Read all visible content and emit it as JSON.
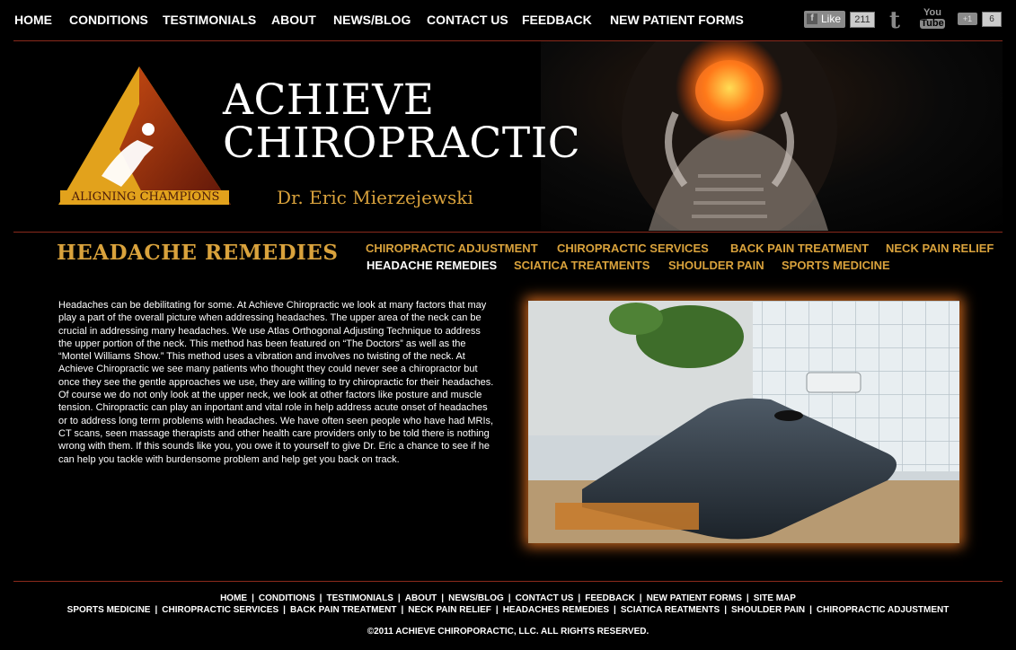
{
  "top_nav": {
    "items": [
      "HOME",
      "CONDITIONS",
      "TESTIMONIALS",
      "ABOUT",
      "NEWS/BLOG",
      "CONTACT US",
      "FEEDBACK",
      "NEW PATIENT FORMS"
    ]
  },
  "social": {
    "facebook_label": "Like",
    "facebook_count": "211",
    "twitter_glyph": "t",
    "youtube_top": "You",
    "youtube_bottom": "Tube",
    "gplus_label": "+1",
    "gplus_count": "6"
  },
  "banner": {
    "title_line1": "ACHIEVE",
    "title_line2": "CHIROPRACTIC",
    "doctor": "Dr. Eric Mierzejewski",
    "triangle_label": "ALIGNING CHAMPIONS"
  },
  "page": {
    "title": "HEADACHE REMEDIES"
  },
  "sub_nav": {
    "row1": [
      "CHIROPRACTIC ADJUSTMENT",
      "CHIROPRACTIC SERVICES",
      "BACK PAIN TREATMENT",
      "NECK PAIN RELIEF"
    ],
    "row2": [
      "HEADACHE REMEDIES",
      "SCIATICA TREATMENTS",
      "SHOULDER PAIN",
      "SPORTS MEDICINE"
    ],
    "active": "HEADACHE REMEDIES"
  },
  "body": {
    "text": "Headaches can be debilitating for some. At Achieve Chiropractic we look at many factors that may play a part of the overall picture when addressing headaches. The upper area of the neck can be crucial in addressing many headaches. We use Atlas Orthogonal Adjusting Technique to address the upper portion of the neck. This method has been featured on “The Doctors” as well as the “Montel Williams Show.” This method uses a vibration and involves no twisting of the neck. At Achieve Chiropractic we see many patients who thought they could never see a chiropractor but once they see the gentle approaches we use, they are willing to try chiropractic for their headaches. Of course we do not only look at the upper neck, we look at other factors like posture and  muscle tension. Chiropractic can play an inportant and vital role in help address acute onset of headaches or to address long term problems with headaches. We have often seen people who have had MRIs, CT scans, seen massage therapists and other health care providers only to be told there is nothing wrong with them. If this sounds like you, you owe it to yourself to give Dr. Eric a chance to see if he can help you tackle with burdensome problem and help get you back on track."
  },
  "footer": {
    "row1": [
      "HOME",
      "CONDITIONS",
      "TESTIMONIALS",
      "ABOUT",
      "NEWS/BLOG",
      "CONTACT US",
      "FEEDBACK",
      "NEW PATIENT FORMS",
      "SITE MAP"
    ],
    "row2": [
      "SPORTS MEDICINE",
      "CHIROPRACTIC SERVICES",
      "BACK PAIN TREATMENT",
      "NECK PAIN RELIEF",
      "HEADACHES REMEDIES",
      "SCIATICA REATMENTS",
      "SHOULDER PAIN",
      "CHIROPRACTIC ADJUSTMENT"
    ],
    "separator": "|",
    "copyright": "©2011 ACHIEVE CHIROPORACTIC, LLC. ALL RIGHTS RESERVED."
  },
  "colors": {
    "accent_gold": "#d9a23c",
    "rule_red": "#8b2a1c",
    "photo_glow": "#c2621c"
  }
}
